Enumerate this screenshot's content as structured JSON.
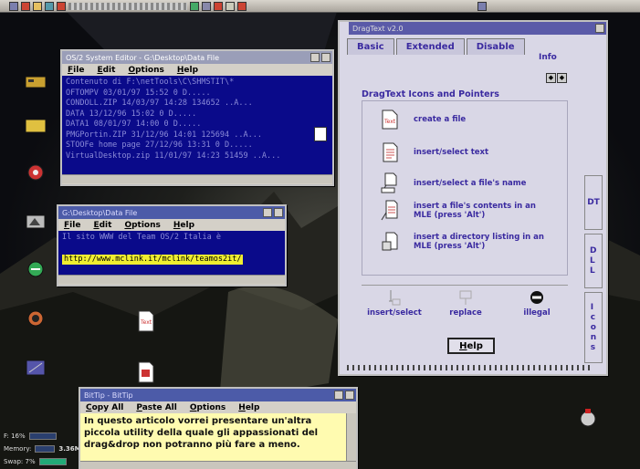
{
  "system_editor": {
    "title": "OS/2 System Editor - G:\\Desktop\\Data File",
    "menu": [
      "File",
      "Edit",
      "Options",
      "Help"
    ],
    "lines": [
      "Contenuto di F:\\netTools\\C\\SHMSTIT\\*",
      "OFTOMPV 03/01/97  15:52       0 D.....",
      "CONDOLL.ZIP 14/03/97  14:28  134652 ..A...",
      "DATA 13/12/96  15:02         0 D.....",
      "DATA1 08/01/97  14:00         0 D.....",
      "PMGPortin.ZIP 31/12/96  14:01  125694 ..A...",
      "STOOFe home page 27/12/96  13:31       0 D.....",
      "VirtualDesktop.zip 11/01/97  14:23   51459 ..A..."
    ]
  },
  "data_file": {
    "title": "G:\\Desktop\\Data File",
    "menu": [
      "File",
      "Edit",
      "Options",
      "Help"
    ],
    "line": "Il sito WWW del Team OS/2 Italia è",
    "url": "http://www.mclink.it/mclink/teamos2it/"
  },
  "dragtext": {
    "title": "DragText v2.0",
    "tabs": [
      "Basic",
      "Extended",
      "Disable"
    ],
    "info_tab": "Info",
    "section": "DragText Icons and Pointers",
    "items": [
      {
        "icon": "create-file-icon",
        "label": "create a file"
      },
      {
        "icon": "insert-text-icon",
        "label": "insert/select text"
      },
      {
        "icon": "insert-name-icon",
        "label": "insert/select a file's name"
      },
      {
        "icon": "insert-contents-icon",
        "label": "insert a file's contents in an MLE (press 'Alt')"
      },
      {
        "icon": "directory-listing-icon",
        "label": "insert a directory listing in an MLE (press 'Alt')"
      }
    ],
    "pointers": [
      "insert/select",
      "replace",
      "illegal"
    ],
    "side_tabs": [
      "DT",
      "DLL",
      "Icons"
    ],
    "help_label": "Help"
  },
  "bittip": {
    "title": "BitTip - BitTip",
    "menu": [
      "Copy All",
      "Paste All",
      "Options",
      "Help"
    ],
    "text": "In questo articolo vorrei presentare un'altra piccola utility della quale gli appassionati del drag&drop non potranno più fare a meno."
  },
  "status": {
    "cpu_label": "F: 16%",
    "memory_label": "Memory:",
    "memory_value": "3.36M",
    "swap_label": "Swap: 7%"
  },
  "colors": {
    "accent": "#3a2aa0",
    "titlebar": "#4c5ba8",
    "editor_bg": "#0a0a8a",
    "note_bg": "#fffbb0"
  }
}
